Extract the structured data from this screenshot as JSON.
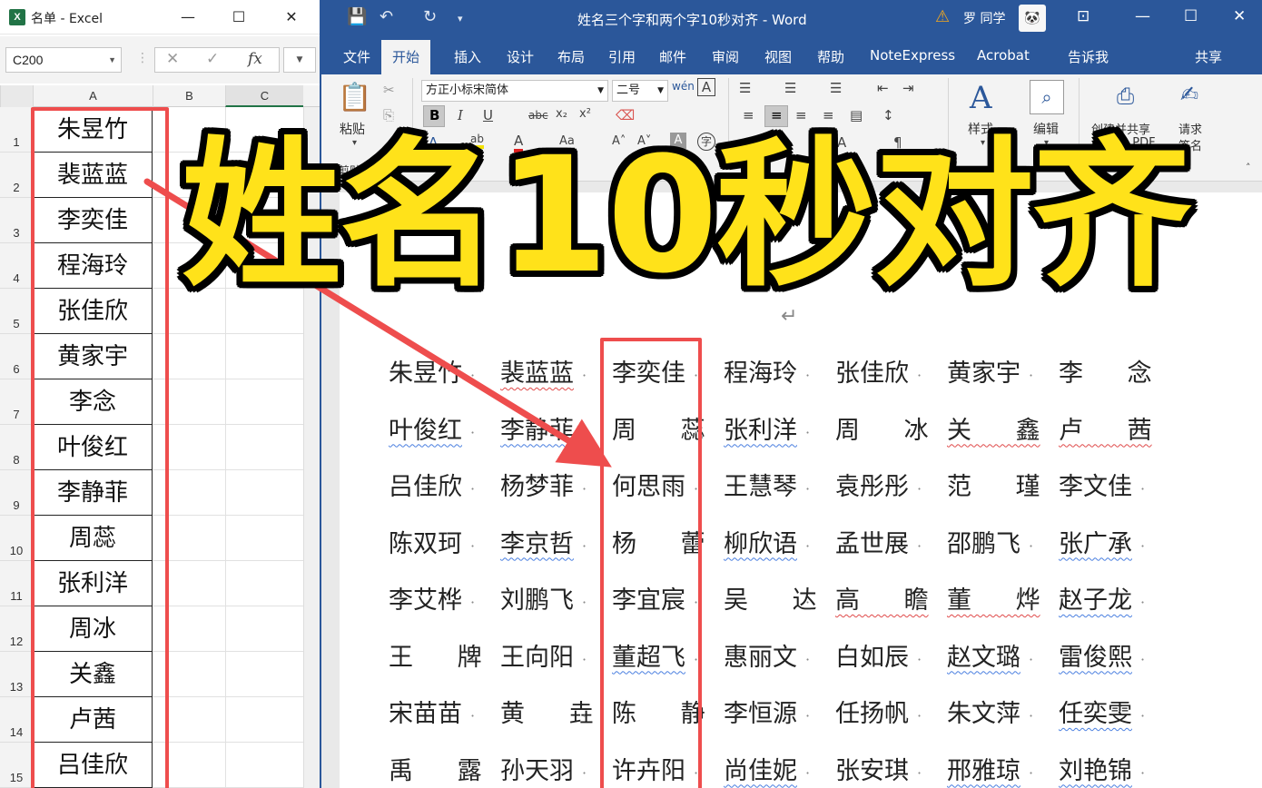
{
  "excel": {
    "window_title": "名单 - Excel",
    "logo_letter": "X",
    "name_box": "C200",
    "fx_label": "fx",
    "cancel_glyph": "✕",
    "enter_glyph": "✓",
    "columns": [
      "A",
      "B",
      "C"
    ],
    "rows": [
      {
        "num": "1",
        "name": "朱昱竹"
      },
      {
        "num": "2",
        "name": "裴蓝蓝"
      },
      {
        "num": "3",
        "name": "李奕佳"
      },
      {
        "num": "4",
        "name": "程海玲"
      },
      {
        "num": "5",
        "name": "张佳欣"
      },
      {
        "num": "6",
        "name": "黄家宇"
      },
      {
        "num": "7",
        "name": "李念"
      },
      {
        "num": "8",
        "name": "叶俊红"
      },
      {
        "num": "9",
        "name": "李静菲"
      },
      {
        "num": "10",
        "name": "周蕊"
      },
      {
        "num": "11",
        "name": "张利洋"
      },
      {
        "num": "12",
        "name": "周冰"
      },
      {
        "num": "13",
        "name": "关鑫"
      },
      {
        "num": "14",
        "name": "卢茜"
      },
      {
        "num": "15",
        "name": "吕佳欣"
      }
    ]
  },
  "word": {
    "doc_title": "姓名三个字和两个字10秒对齐 - Word",
    "user_name": "罗 同学",
    "avatar_text": "🐼",
    "tabs": [
      "文件",
      "开始",
      "插入",
      "设计",
      "布局",
      "引用",
      "邮件",
      "审阅",
      "视图",
      "帮助",
      "NoteExpress",
      "Acrobat",
      "告诉我",
      "共享"
    ],
    "active_tab": "开始",
    "ribbon": {
      "paste_label": "粘贴",
      "font_name": "方正小标宋简体",
      "font_size": "二号",
      "clipboard_group": "剪贴板",
      "font_group": "本",
      "paragraph_group": "段落",
      "styles_label": "样式",
      "edit_label": "编辑",
      "create_share_label_1": "创建并共享",
      "create_share_label_2": "Adobe PDF",
      "request_sign_label_1": "请求",
      "request_sign_label_2": "签名",
      "acrobat_group": "e Acrobat"
    },
    "paragraph_mark": "↵",
    "name_rows": [
      [
        "朱昱竹",
        "裴蓝蓝",
        "李奕佳",
        "程海玲",
        "张佳欣",
        "黄家宇",
        "李 念"
      ],
      [
        "叶俊红",
        "李静菲",
        "周 蕊",
        "张利洋",
        "周 冰",
        "关 鑫",
        "卢 茜"
      ],
      [
        "吕佳欣",
        "杨梦菲",
        "何思雨",
        "王慧琴",
        "袁彤彤",
        "范 瑾",
        "李文佳"
      ],
      [
        "陈双珂",
        "李京哲",
        "杨 蕾",
        "柳欣语",
        "孟世展",
        "邵鹏飞",
        "张广承"
      ],
      [
        "李艾桦",
        "刘鹏飞",
        "李宜宸",
        "吴 达",
        "高 瞻",
        "董 烨",
        "赵子龙"
      ],
      [
        "王 牌",
        "王向阳",
        "董超飞",
        "惠丽文",
        "白如辰",
        "赵文璐",
        "雷俊熙"
      ],
      [
        "宋苗苗",
        "黄 垚",
        "陈 静",
        "李恒源",
        "任扬帆",
        "朱文萍",
        "任奕雯"
      ],
      [
        "禹 露",
        "孙天羽",
        "许卉阳",
        "尚佳妮",
        "张安琪",
        "邢雅琼",
        "刘艳锦"
      ]
    ]
  },
  "overlay": {
    "headline": "姓名10秒对齐",
    "accent_color": "#ffe21a",
    "box_color": "#ee4d4d"
  }
}
